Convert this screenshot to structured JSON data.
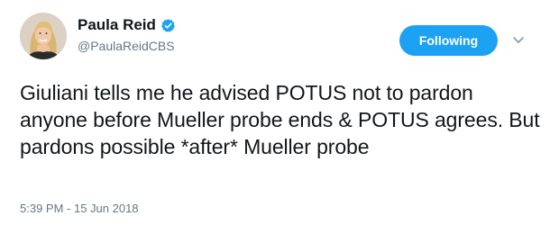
{
  "author": {
    "display_name": "Paula Reid",
    "handle": "@PaulaReidCBS",
    "verified": true
  },
  "follow_button": {
    "label": "Following"
  },
  "tweet": {
    "text": "Giuliani tells me he advised POTUS not to pardon anyone before Mueller probe ends & POTUS agrees. But pardons possible *after* Mueller probe",
    "timestamp": "5:39 PM - 15 Jun 2018"
  },
  "colors": {
    "accent": "#1da1f2",
    "secondary_text": "#657786",
    "primary_text": "#14171a"
  },
  "icons": {
    "verified": "verified-badge-icon",
    "more": "chevron-down-icon"
  }
}
